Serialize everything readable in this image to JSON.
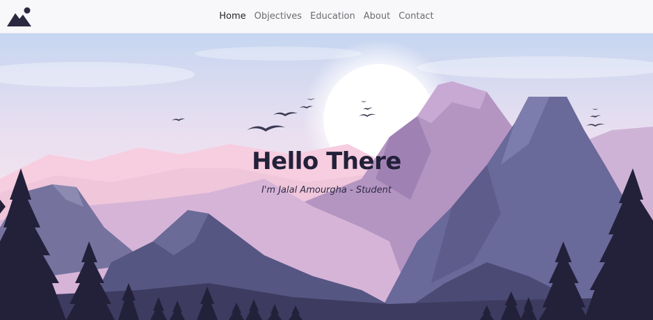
{
  "nav": {
    "logo_icon": "mountain-logo-icon",
    "links": [
      {
        "label": "Home",
        "active": true
      },
      {
        "label": "Objectives",
        "active": false
      },
      {
        "label": "Education",
        "active": false
      },
      {
        "label": "About",
        "active": false
      },
      {
        "label": "Contact",
        "active": false
      }
    ]
  },
  "hero": {
    "title": "Hello There",
    "subtitle": "I'm Jalal Amourgha - Student",
    "background": "mountain-landscape-illustration"
  },
  "colors": {
    "navbar_bg": "#f8f8fa",
    "nav_active": "#222228",
    "nav_inactive": "#6b6b72",
    "sky_top": "#c9d8f0",
    "sky_pink": "#f7d3e2",
    "mountain_purple": "#b49ac4",
    "mountain_slate": "#6b6b92",
    "forest": "#23213a"
  }
}
